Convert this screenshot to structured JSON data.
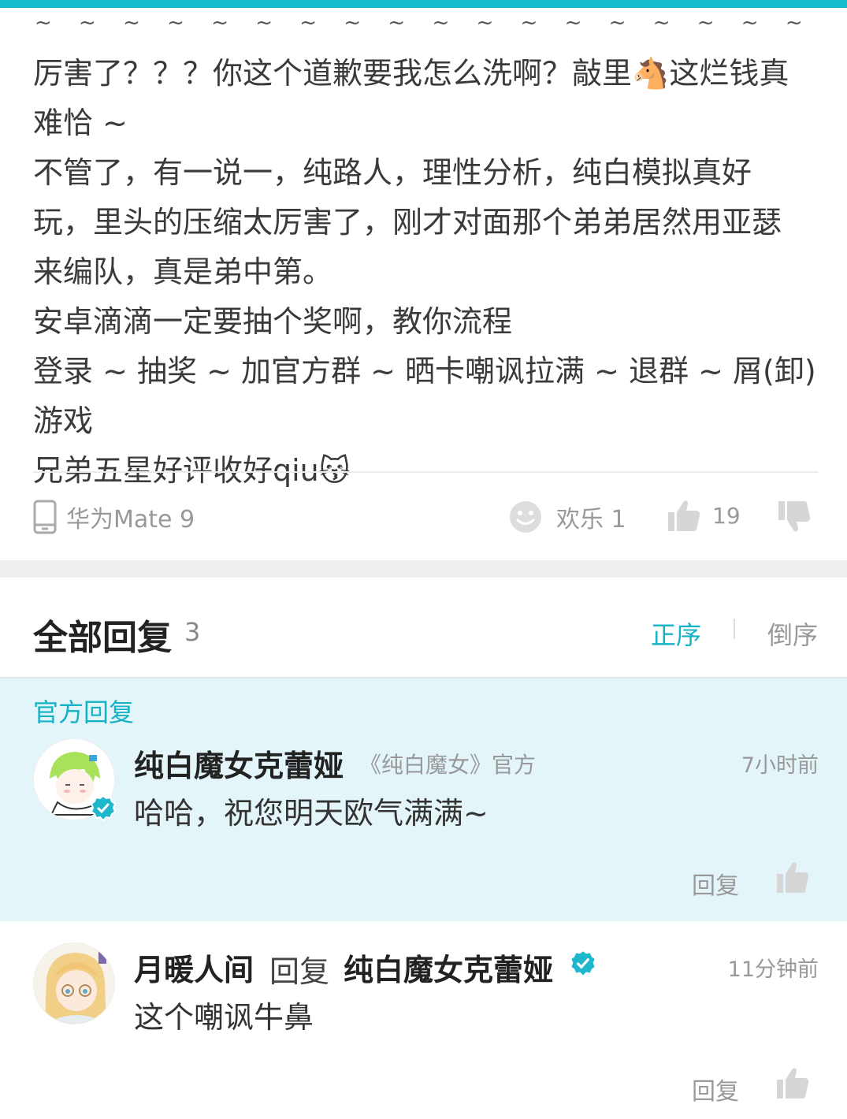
{
  "review": {
    "tilde_row": "~ ~ ~ ~ ~ ~ ~ ~ ~ ~ ~ ~ ~ ~ ~ ~ ~ ~ ~ ~ ~ ~ ~ ~ ~ ~",
    "line1": "厉害了？？？你这个道歉要我怎么洗啊？敲里🐴这烂钱真",
    "line2": "难恰 ~",
    "line3": "不管了，有一说一，纯路人，理性分析，纯白模拟真好",
    "line4": "玩，里头的压缩太厉害了，刚才对面那个弟弟居然用亚瑟",
    "line5": "来编队，真是弟中第。",
    "line6": "安卓滴滴一定要抽个奖啊，教你流程",
    "line7": "登录 ~ 抽奖 ~ 加官方群 ~ 晒卡嘲讽拉满 ~ 退群 ~ 屑(卸)游戏",
    "line8": "兄弟五星好评收好qiu😽"
  },
  "footer": {
    "device": "华为Mate 9",
    "reaction_label": "欢乐 1",
    "like_count": "19",
    "icons": [
      "phone-icon",
      "smiley-icon",
      "thumbs-up-icon",
      "thumbs-down-icon"
    ]
  },
  "replies": {
    "title": "全部回复",
    "count": "3",
    "sort_asc": "正序",
    "sort_desc": "倒序",
    "official_tag": "官方回复",
    "items": [
      {
        "name": "纯白魔女克蕾娅",
        "sub": "《纯白魔女》官方",
        "time": "7小时前",
        "content": "哈哈，祝您明天欧气满满~",
        "reply_label": "回复"
      },
      {
        "name": "月暖人间",
        "reply_word": "回复",
        "target": "纯白魔女克蕾娅",
        "time": "11分钟前",
        "content": "这个嘲讽牛鼻",
        "reply_label": "回复"
      }
    ]
  },
  "colors": {
    "accent": "#14bccc",
    "official_bg": "#e4f5fa",
    "verify": "#1fb7cb"
  }
}
